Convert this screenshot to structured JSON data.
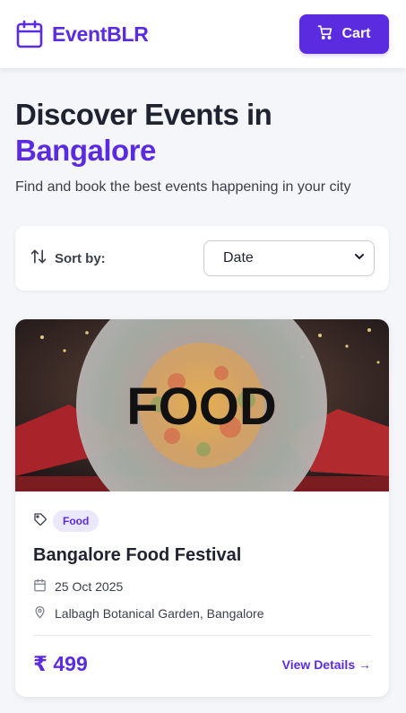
{
  "header": {
    "brand": "EventBLR",
    "cart_label": "Cart",
    "brand_color": "#5b2be0"
  },
  "hero": {
    "title_line1": "Discover Events in",
    "title_line2": "Bangalore",
    "subtitle": "Find and book the best events happening in your city"
  },
  "sort": {
    "label": "Sort by:",
    "selected": "Date",
    "icon": "sort-arrows-icon"
  },
  "events": [
    {
      "image_text": "FOOD",
      "category": "Food",
      "title": "Bangalore Food Festival",
      "date": "25 Oct 2025",
      "location": "Lalbagh Botanical Garden, Bangalore",
      "price": "₹ 499",
      "cta": "View Details →"
    }
  ]
}
